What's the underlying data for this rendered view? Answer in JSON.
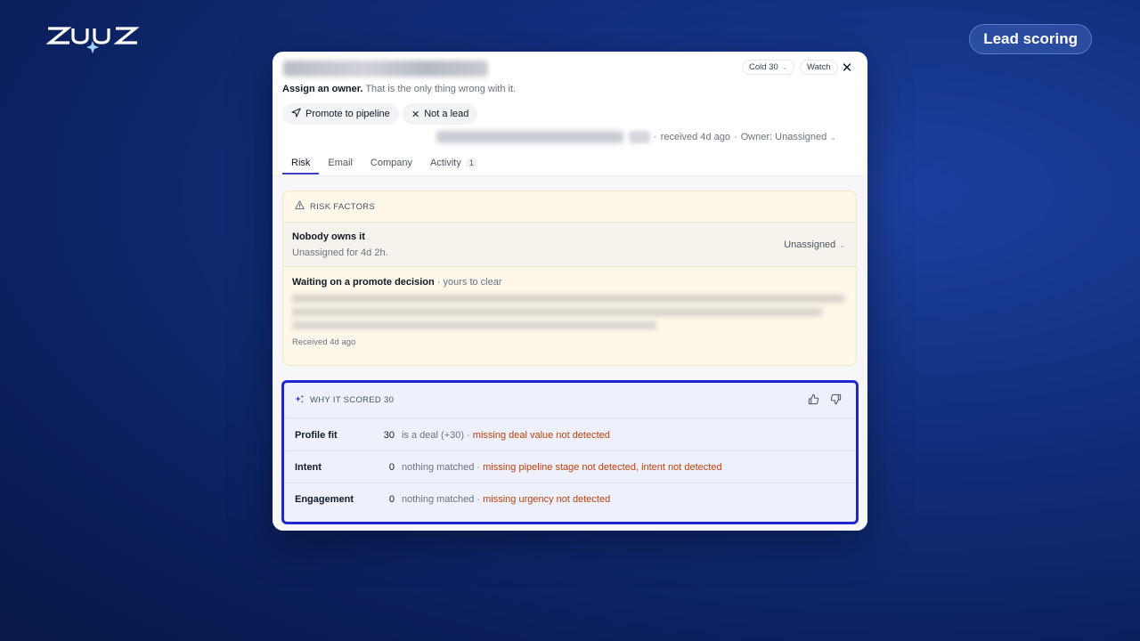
{
  "brand": {
    "logo_text": "ZUUS",
    "badge": "Lead scoring"
  },
  "lead": {
    "chip_cold": "Cold 30",
    "chip_watch": "Watch",
    "assign_bold": "Assign an owner.",
    "assign_rest": " That is the only thing wrong with it.",
    "actions": {
      "promote": "Promote to pipeline",
      "not_lead": "Not a lead"
    },
    "received": "received 4d ago",
    "owner": "Owner: Unassigned"
  },
  "tabs": [
    {
      "label": "Risk",
      "active": true
    },
    {
      "label": "Email"
    },
    {
      "label": "Company"
    },
    {
      "label": "Activity",
      "badge": "1"
    }
  ],
  "risk": {
    "heading": "RISK FACTORS",
    "item1": {
      "title": "Nobody owns it",
      "sub": "Unassigned for 4d 2h.",
      "owner_select": "Unassigned"
    },
    "item2": {
      "title": "Waiting on a promote decision",
      "suffix": " · yours to clear",
      "received": "Received 4d ago"
    }
  },
  "score": {
    "heading": "WHY IT SCORED 30",
    "rows": [
      {
        "label": "Profile fit",
        "value": "30",
        "matched": "is a deal (+30) · ",
        "missing": "missing deal value not detected"
      },
      {
        "label": "Intent",
        "value": "0",
        "matched": "nothing matched · ",
        "missing": "missing pipeline stage not detected, intent not detected"
      },
      {
        "label": "Engagement",
        "value": "0",
        "matched": "nothing matched · ",
        "missing": "missing urgency not detected"
      }
    ]
  },
  "colors": {
    "accent": "#2027cf",
    "missing": "#c2410c",
    "risk_bg": "#fdf8ea"
  }
}
